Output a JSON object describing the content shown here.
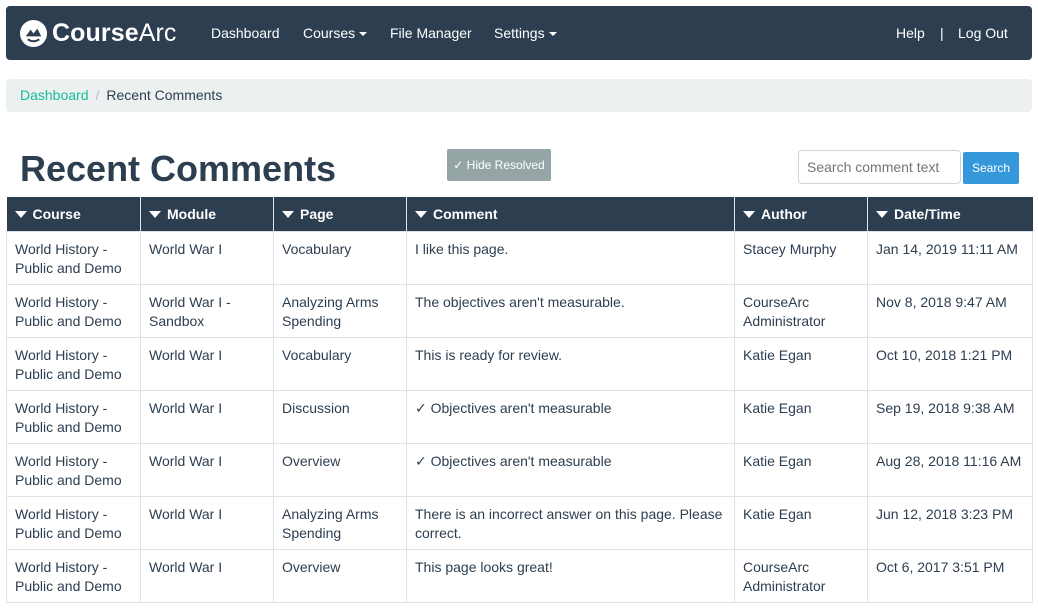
{
  "brand": {
    "name_part1": "Course",
    "name_part2": "Arc"
  },
  "nav": {
    "items": [
      {
        "label": "Dashboard",
        "has_caret": false
      },
      {
        "label": "Courses",
        "has_caret": true
      },
      {
        "label": "File Manager",
        "has_caret": false
      },
      {
        "label": "Settings",
        "has_caret": true
      }
    ],
    "help": "Help",
    "separator": "|",
    "logout": "Log Out"
  },
  "breadcrumb": {
    "link": "Dashboard",
    "separator": "/",
    "current": "Recent Comments"
  },
  "page": {
    "title": "Recent Comments",
    "hide_resolved": "✓ Hide Resolved",
    "search_placeholder": "Search comment text",
    "search_button": "Search"
  },
  "table": {
    "headers": [
      "Course",
      "Module",
      "Page",
      "Comment",
      "Author",
      "Date/Time"
    ],
    "rows": [
      {
        "course": "World History - Public and Demo",
        "module": "World War I",
        "page": "Vocabulary",
        "comment": "I like this page.",
        "author": "Stacey Murphy",
        "datetime": "Jan 14, 2019 11:11 AM"
      },
      {
        "course": "World History - Public and Demo",
        "module": "World War I - Sandbox",
        "page": "Analyzing Arms Spending",
        "comment": "The objectives aren't measurable.",
        "author": "CourseArc Administrator",
        "datetime": "Nov 8, 2018 9:47 AM"
      },
      {
        "course": "World History - Public and Demo",
        "module": "World War I",
        "page": "Vocabulary",
        "comment": "This is ready for review.",
        "author": "Katie Egan",
        "datetime": "Oct 10, 2018 1:21 PM"
      },
      {
        "course": "World History - Public and Demo",
        "module": "World War I",
        "page": "Discussion",
        "comment": "✓ Objectives aren't measurable",
        "author": "Katie Egan",
        "datetime": "Sep 19, 2018 9:38 AM"
      },
      {
        "course": "World History - Public and Demo",
        "module": "World War I",
        "page": "Overview",
        "comment": "✓ Objectives aren't measurable",
        "author": "Katie Egan",
        "datetime": "Aug 28, 2018 11:16 AM"
      },
      {
        "course": "World History - Public and Demo",
        "module": "World War I",
        "page": "Analyzing Arms Spending",
        "comment": "There is an incorrect answer on this page. Please correct.",
        "author": "Katie Egan",
        "datetime": "Jun 12, 2018 3:23 PM"
      },
      {
        "course": "World History - Public and Demo",
        "module": "World War I",
        "page": "Overview",
        "comment": "This page looks great!",
        "author": "CourseArc Administrator",
        "datetime": "Oct 6, 2017 3:51 PM"
      }
    ]
  },
  "colors": {
    "navbar": "#2c3e50",
    "link": "#18bc9c",
    "hide_resolved": "#95a5a6",
    "search_button": "#3498db"
  }
}
